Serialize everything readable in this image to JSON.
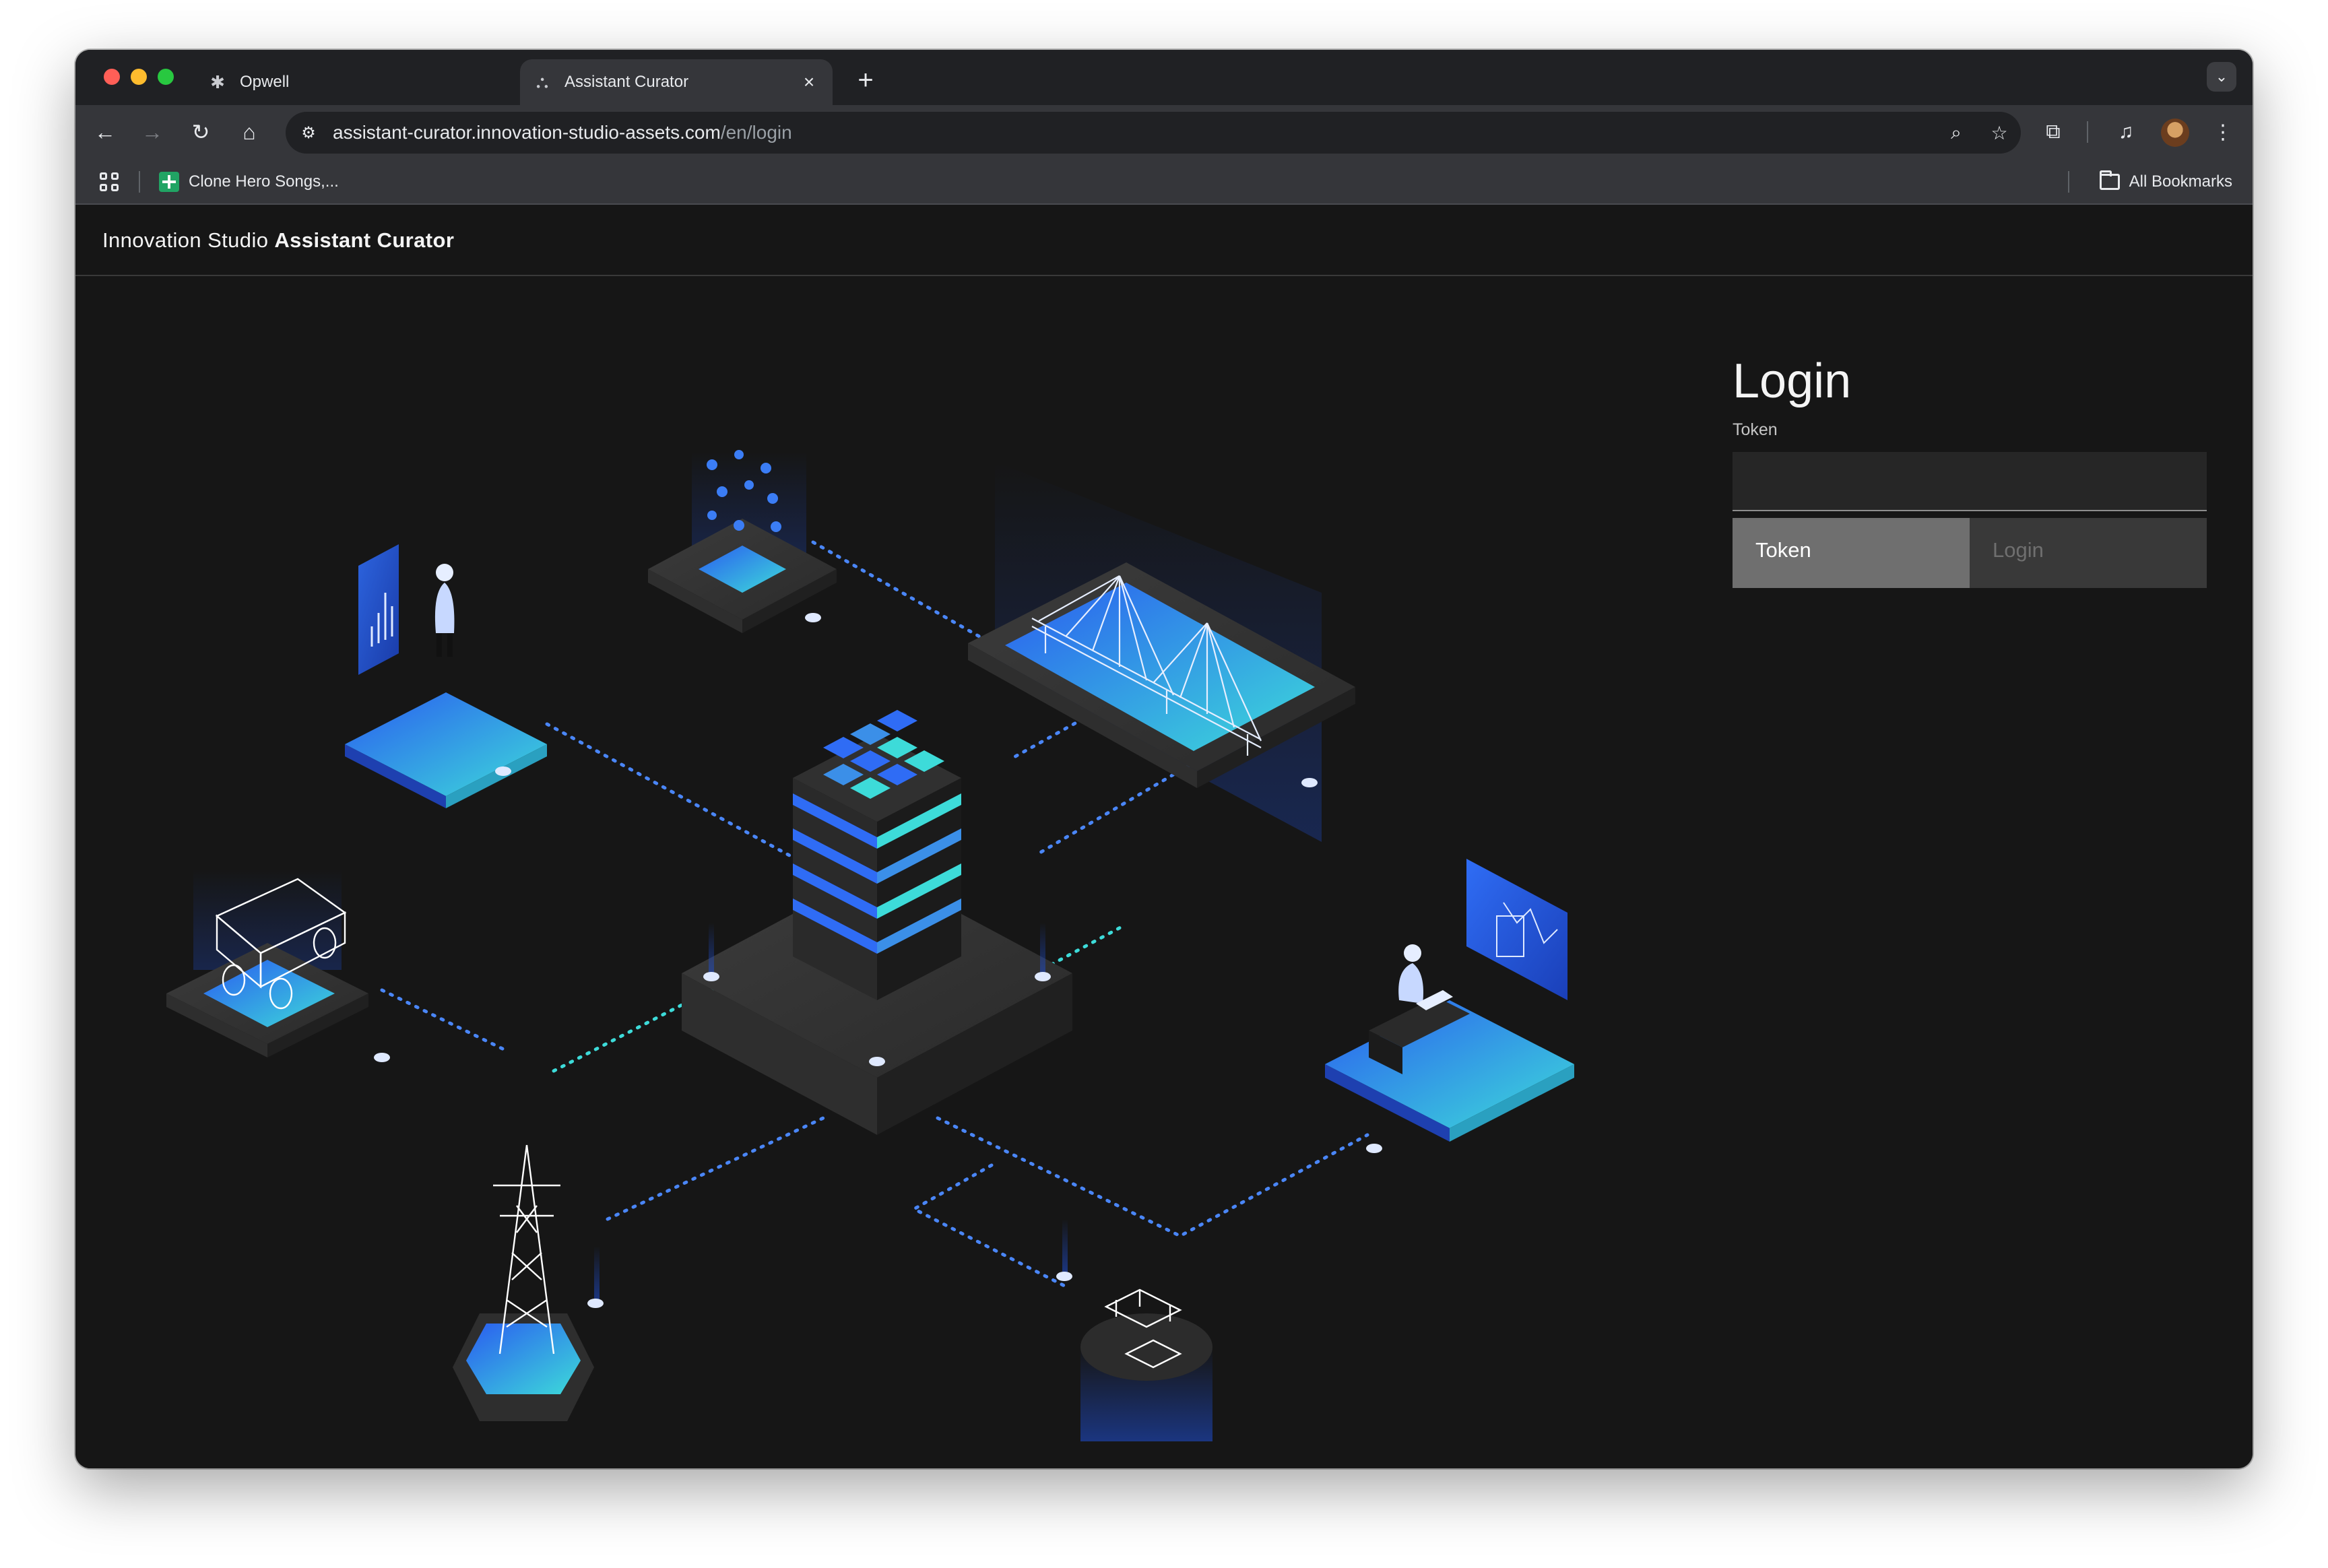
{
  "browser": {
    "tabs": [
      {
        "title": "Opwell",
        "icon": "opwell-icon",
        "active": false
      },
      {
        "title": "Assistant Curator",
        "icon": "assistant-curator-icon",
        "active": true
      }
    ],
    "new_tab_label": "+",
    "url": {
      "host": "assistant-curator.innovation-studio-assets.com",
      "path": "/en/login"
    },
    "bookmarks": [
      {
        "label": "Clone Hero Songs,...",
        "icon": "google-sheets-icon"
      }
    ],
    "all_bookmarks_label": "All Bookmarks"
  },
  "app": {
    "brand_prefix": "Innovation Studio",
    "brand_name": "Assistant Curator"
  },
  "login": {
    "title": "Login",
    "token_label": "Token",
    "token_value": "",
    "token_placeholder": "",
    "token_button": "Token",
    "login_button": "Login"
  },
  "colors": {
    "page_bg": "#161616",
    "accent_blue": "#3d6ef5",
    "accent_teal": "#3ddbd9",
    "token_button_bg": "#6f6f6f",
    "login_button_bg": "#393939"
  }
}
